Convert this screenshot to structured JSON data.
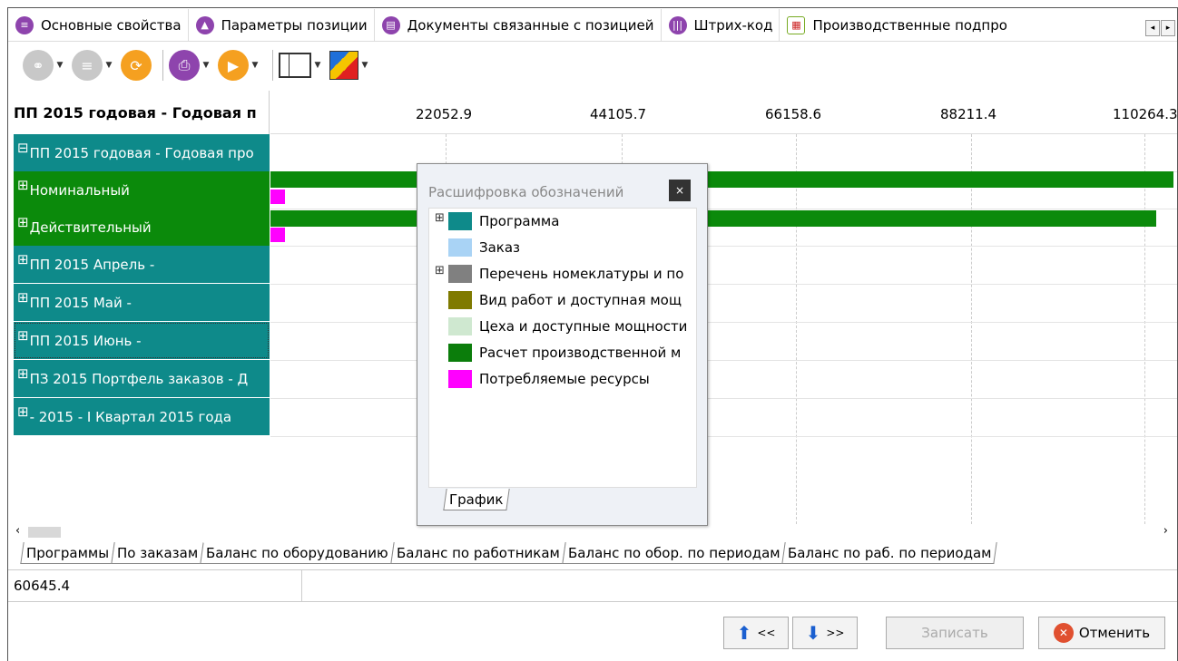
{
  "top_tabs": [
    {
      "label": "Основные свойства",
      "icon": "list-icon"
    },
    {
      "label": "Параметры позиции",
      "icon": "params-icon"
    },
    {
      "label": "Документы связанные с позицией",
      "icon": "document-icon"
    },
    {
      "label": "Штрих-код",
      "icon": "barcode-icon"
    },
    {
      "label": "Производственные подпро",
      "icon": "table-icon"
    }
  ],
  "tab_scroll": {
    "left": "◂",
    "right": "▸"
  },
  "grid": {
    "header": "ПП 2015 годовая - Годовая п",
    "scale": [
      "22052.9",
      "44105.7",
      "66158.6",
      "88211.4",
      "110264.3"
    ],
    "rows": [
      {
        "label": "ПП 2015 годовая - Годовая про",
        "pm": "⊟"
      },
      {
        "label": "Номинальный",
        "pm": "⊞"
      },
      {
        "label": "Действительный",
        "pm": "⊞"
      },
      {
        "label": "ПП 2015 Апрель -",
        "pm": "⊞"
      },
      {
        "label": "ПП 2015 Май -",
        "pm": "⊞"
      },
      {
        "label": "ПП 2015 Июнь -",
        "pm": "⊞"
      },
      {
        "label": "ПЗ 2015 Портфель заказов - Д",
        "pm": "⊞"
      },
      {
        "label": " - 2015 - I Квартал 2015 года",
        "pm": "⊞"
      }
    ]
  },
  "legend": {
    "title": "Расшифровка обозначений",
    "close": "×",
    "items": [
      {
        "label": "Программа",
        "color": "#0e8a8a",
        "expand": "⊞"
      },
      {
        "label": "Заказ",
        "color": "#a9d3f5",
        "expand": ""
      },
      {
        "label": "Перечень номеклатуры и по",
        "color": "#808080",
        "expand": "⊞"
      },
      {
        "label": "Вид работ и доступная мощ",
        "color": "#7f7a00",
        "expand": ""
      },
      {
        "label": "Цеха и доступные мощности",
        "color": "#cfe8d0",
        "expand": ""
      },
      {
        "label": "Расчет производственной м",
        "color": "#0b7d0b",
        "expand": ""
      },
      {
        "label": "Потребляемые ресурсы",
        "color": "#ff00ff",
        "expand": ""
      }
    ],
    "tab": "График"
  },
  "bottom_tabs": [
    "Программы",
    "По заказам",
    "Баланс по оборудованию",
    "Баланс по работникам",
    "Баланс по обор. по периодам",
    "Баланс по раб. по периодам"
  ],
  "status_value": "60645.4",
  "buttons": {
    "prev": "<<",
    "next": ">>",
    "save": "Записать",
    "cancel": "Отменить"
  },
  "colors": {
    "teal": "#0e8a8a",
    "green": "#0b8a0b",
    "magenta": "#ff00ff",
    "purple": "#8e44ad",
    "orange": "#f5a020"
  }
}
